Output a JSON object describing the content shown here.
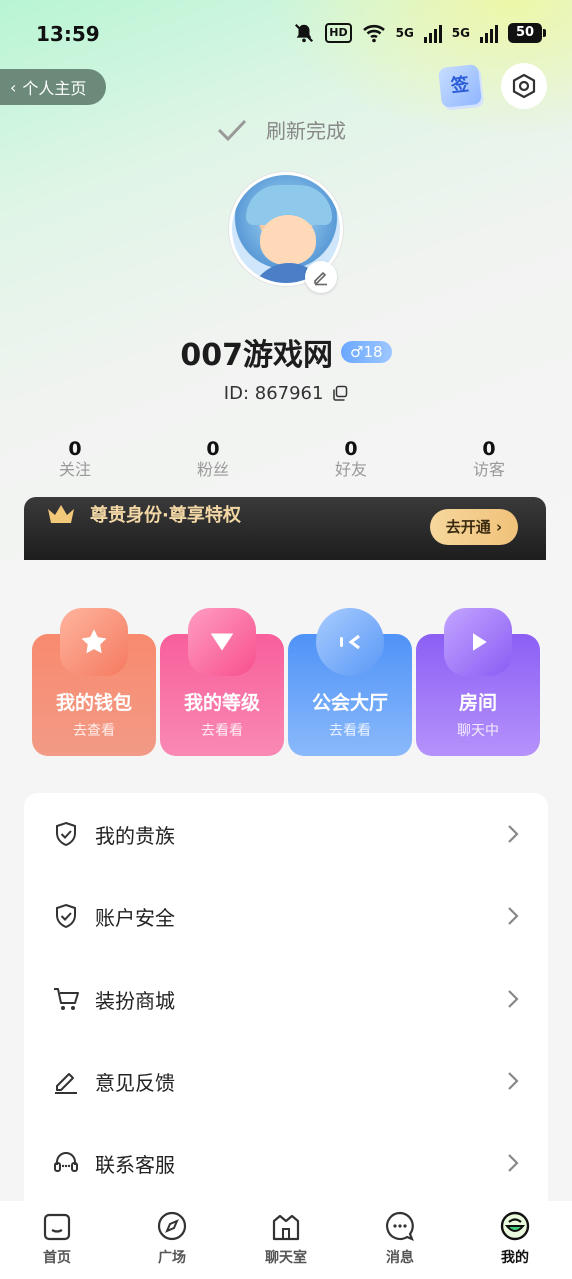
{
  "status_bar": {
    "time": "13:59",
    "hd_label": "HD",
    "net1": "5G",
    "net2": "5G",
    "battery": "50"
  },
  "header": {
    "back_label": "个人主页",
    "sign_label": "签",
    "refresh_text": "刷新完成"
  },
  "profile": {
    "username": "007游戏网",
    "gender_age": "♂18",
    "user_id": "ID: 867961"
  },
  "stats": [
    {
      "value": "0",
      "label": "关注"
    },
    {
      "value": "0",
      "label": "粉丝"
    },
    {
      "value": "0",
      "label": "好友"
    },
    {
      "value": "0",
      "label": "访客"
    }
  ],
  "vip": {
    "text": "尊贵身份·尊享特权",
    "button": "去开通"
  },
  "features": [
    {
      "title": "我的钱包",
      "subtitle": "去查看",
      "icon": "star-icon",
      "color": "#f26b5a"
    },
    {
      "title": "我的等级",
      "subtitle": "去看看",
      "icon": "level-icon",
      "color": "#f75e96"
    },
    {
      "title": "公会大厅",
      "subtitle": "去看看",
      "icon": "chat-bubble-icon",
      "color": "#5b9dfa"
    },
    {
      "title": "房间",
      "subtitle": "聊天中",
      "icon": "play-icon",
      "color": "#9a6cf6"
    }
  ],
  "menu": [
    {
      "label": "我的贵族",
      "icon": "shield-check-icon"
    },
    {
      "label": "账户安全",
      "icon": "shield-check-icon"
    },
    {
      "label": "装扮商城",
      "icon": "cart-icon"
    },
    {
      "label": "意见反馈",
      "icon": "pencil-icon"
    },
    {
      "label": "联系客服",
      "icon": "headset-icon"
    }
  ],
  "tabbar": [
    {
      "label": "首页",
      "icon": "home-icon"
    },
    {
      "label": "广场",
      "icon": "compass-icon"
    },
    {
      "label": "聊天室",
      "icon": "chatroom-icon"
    },
    {
      "label": "消息",
      "icon": "message-icon"
    },
    {
      "label": "我的",
      "icon": "me-icon",
      "active": true
    }
  ]
}
